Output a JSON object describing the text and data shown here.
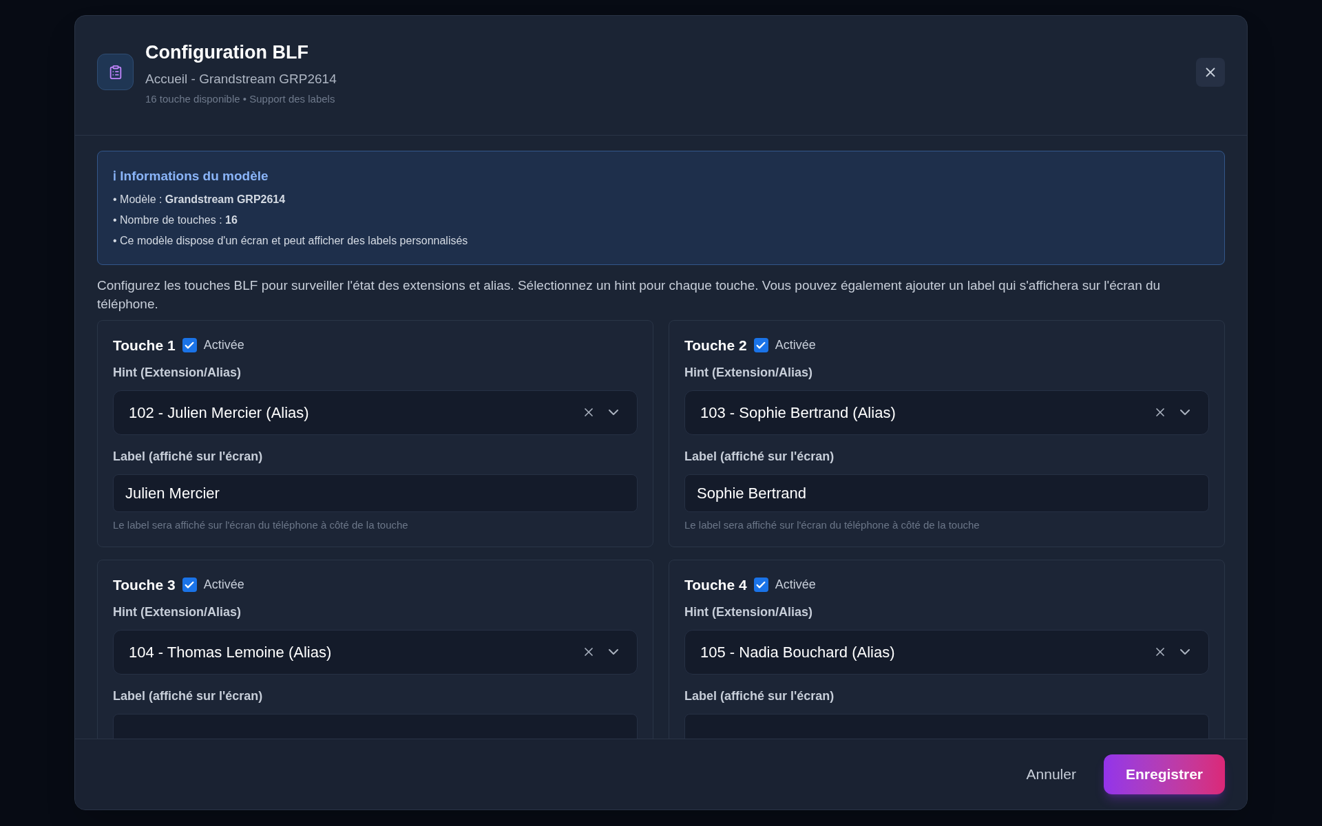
{
  "dialog": {
    "title": "Configuration BLF",
    "subtitle": "Accueil - Grandstream GRP2614",
    "meta": "16 touche disponible • Support des labels"
  },
  "info": {
    "title": "ℹ Informations du modèle",
    "lines": [
      "• Modèle : **Grandstream GRP2614**",
      "• Nombre de touches : **16**",
      "• Ce modèle dispose d'un écran et peut afficher des labels personnalisés"
    ]
  },
  "description": "Configurez les touches BLF pour surveiller l'état des extensions et alias. Sélectionnez un hint pour chaque touche. Vous pouvez également ajouter un label qui s'affichera sur l'écran du téléphone.",
  "keys": [
    {
      "title": "Touche 1",
      "enabled": true,
      "enabled_label": "Activée",
      "hint_label": "Hint (Extension/Alias)",
      "hint_value": "102 - Julien Mercier (Alias)",
      "label_label": "Label (affiché sur l'écran)",
      "label_value": "Julien Mercier",
      "help": "Le label sera affiché sur l'écran du téléphone à côté de la touche"
    },
    {
      "title": "Touche 2",
      "enabled": true,
      "enabled_label": "Activée",
      "hint_label": "Hint (Extension/Alias)",
      "hint_value": "103 - Sophie Bertrand (Alias)",
      "label_label": "Label (affiché sur l'écran)",
      "label_value": "Sophie Bertrand",
      "help": "Le label sera affiché sur l'écran du téléphone à côté de la touche"
    },
    {
      "title": "Touche 3",
      "enabled": true,
      "enabled_label": "Activée",
      "hint_label": "Hint (Extension/Alias)",
      "hint_value": "104 - Thomas Lemoine (Alias)",
      "label_label": "Label (affiché sur l'écran)"
    },
    {
      "title": "Touche 4",
      "enabled": true,
      "enabled_label": "Activée",
      "hint_label": "Hint (Extension/Alias)",
      "hint_value": "105 - Nadia Bouchard (Alias)",
      "label_label": "Label (affiché sur l'écran)"
    }
  ],
  "footer": {
    "cancel": "Annuler",
    "save": "Enregistrer"
  }
}
